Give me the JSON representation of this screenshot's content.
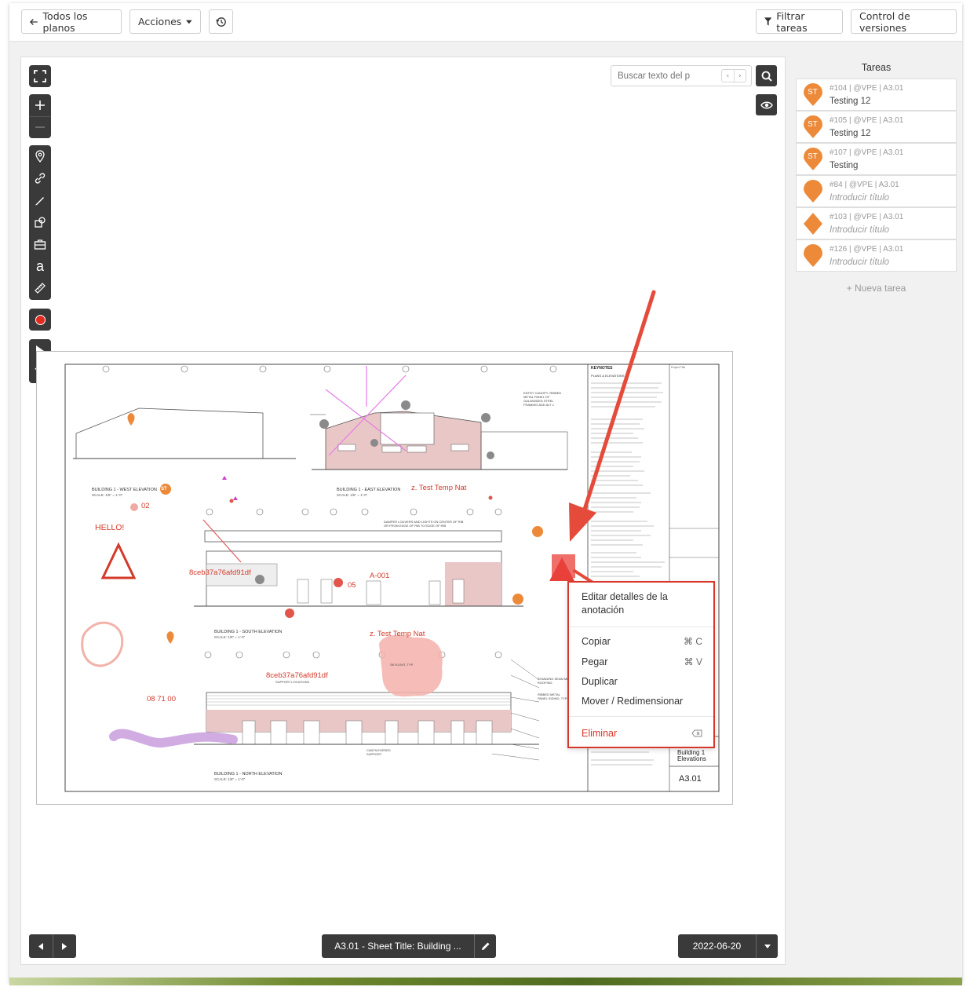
{
  "toolbar": {
    "back_label": "Todos los planos",
    "actions_label": "Acciones",
    "filter_label": "Filtrar tareas",
    "versions_label": "Control de versiones"
  },
  "search": {
    "placeholder": "Buscar texto del p",
    "prev": "‹",
    "next": "›"
  },
  "tasks": {
    "title": "Tareas",
    "items": [
      {
        "meta": "#104 | @VPE | A3.01",
        "title": "Testing 12",
        "pin": "ST",
        "shape": "pin"
      },
      {
        "meta": "#105 | @VPE | A3.01",
        "title": "Testing 12",
        "pin": "ST",
        "shape": "pin"
      },
      {
        "meta": "#107 | @VPE | A3.01",
        "title": "Testing",
        "pin": "ST",
        "shape": "pin"
      },
      {
        "meta": "#84 | @VPE | A3.01",
        "title": "Introducir título",
        "pin": "",
        "shape": "pin"
      },
      {
        "meta": "#103 | @VPE | A3.01",
        "title": "Introducir título",
        "pin": "",
        "shape": "diamond"
      },
      {
        "meta": "#126 | @VPE | A3.01",
        "title": "Introducir título",
        "pin": "",
        "shape": "pin"
      }
    ],
    "new_task": "+ Nueva tarea"
  },
  "context_menu": {
    "edit_line1": "Editar detalles de la",
    "edit_line2": "anotación",
    "copy": "Copiar",
    "copy_shortcut": "⌘ C",
    "paste": "Pegar",
    "paste_shortcut": "⌘ V",
    "duplicate": "Duplicar",
    "move": "Mover / Redimensionar",
    "delete": "Eliminar"
  },
  "bottom": {
    "sheet_title": "A3.01 - Sheet Title: Building ...",
    "date": "2022-06-20"
  },
  "drawing": {
    "annotations": {
      "hello": "HELLO!",
      "num02": "02",
      "test_temp_1": "z. Test Temp Nat",
      "test_temp_2": "z. Test Temp Nat",
      "hash1": "8ceb37a76afd91df",
      "hash2": "8ceb37a76afd91df",
      "a001": "A-001",
      "num05": "05",
      "code": "08 71 00",
      "st": "ST"
    },
    "views": {
      "west": "BUILDING 1 - WEST ELEVATION",
      "east": "BUILDING 1 - EAST ELEVATION",
      "south": "BUILDING 1 - SOUTH ELEVATION",
      "north": "BUILDING 1 - NORTH ELEVATION",
      "scale": "SCALE: 1/8\" = 1'-0\""
    },
    "keynotes_title": "KEYNOTES",
    "keynotes_sub": "PLANS & ELEVATIONS",
    "sheet_name_line1": "Building 1",
    "sheet_name_line2": "Elevations",
    "sheet_number": "A3.01",
    "project_title": "Project Title",
    "callouts": {
      "canopy": "ENTRY CANOPY: RIBBED METAL PANEL OF GALVANIZED STEEL FRAMING ADD ALT 1",
      "louvers": "DAMPER LOUVERS AND LIGHTS ON CENTER OF RIB OR FROM EDGE OF RIB TO EDGE OF RIB",
      "skylight": "SKYLIGHT, TYP.",
      "support": "SUPPORT LOCATIONS",
      "cantilever": "CANTILEVERED SUPPORT",
      "standing_seam": "STANDING SEAM METAL ROOFING",
      "ribbed": "RIBBED METAL PANEL SIDING, TYP."
    }
  }
}
